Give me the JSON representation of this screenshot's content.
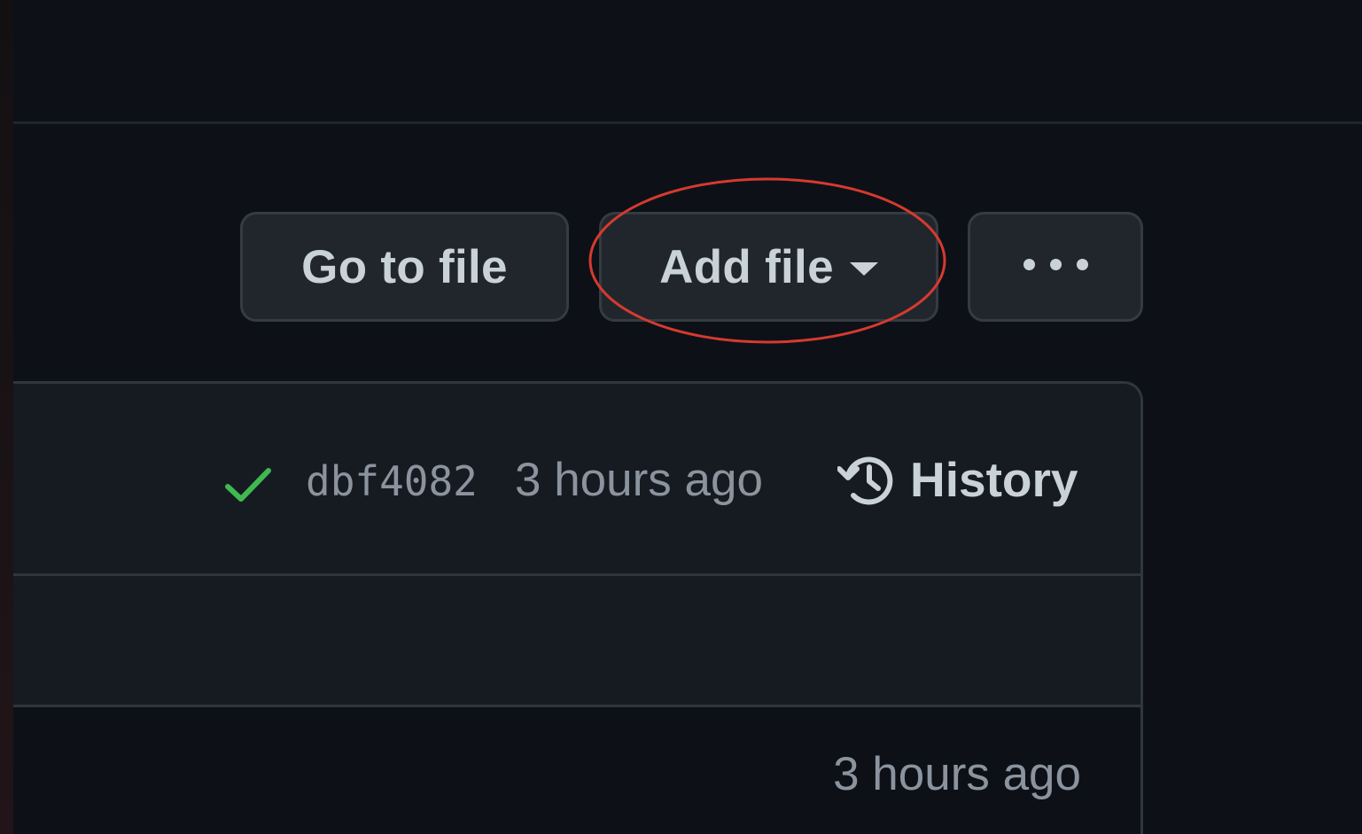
{
  "toolbar": {
    "go_to_file_label": "Go to file",
    "add_file_label": "Add file",
    "more_icon": "kebab-horizontal-icon"
  },
  "latest_commit": {
    "status_icon": "check-icon",
    "sha": "dbf4082",
    "time": "3 hours ago",
    "history_icon": "history-icon",
    "history_label": "History"
  },
  "files": [
    {
      "time": "3 hours ago"
    }
  ],
  "colors": {
    "background": "#0d1117",
    "button_bg": "#21262d",
    "text_primary": "#c9d1d9",
    "text_muted": "#8b949e",
    "success": "#3fb950",
    "annotation": "#d63a2f"
  }
}
